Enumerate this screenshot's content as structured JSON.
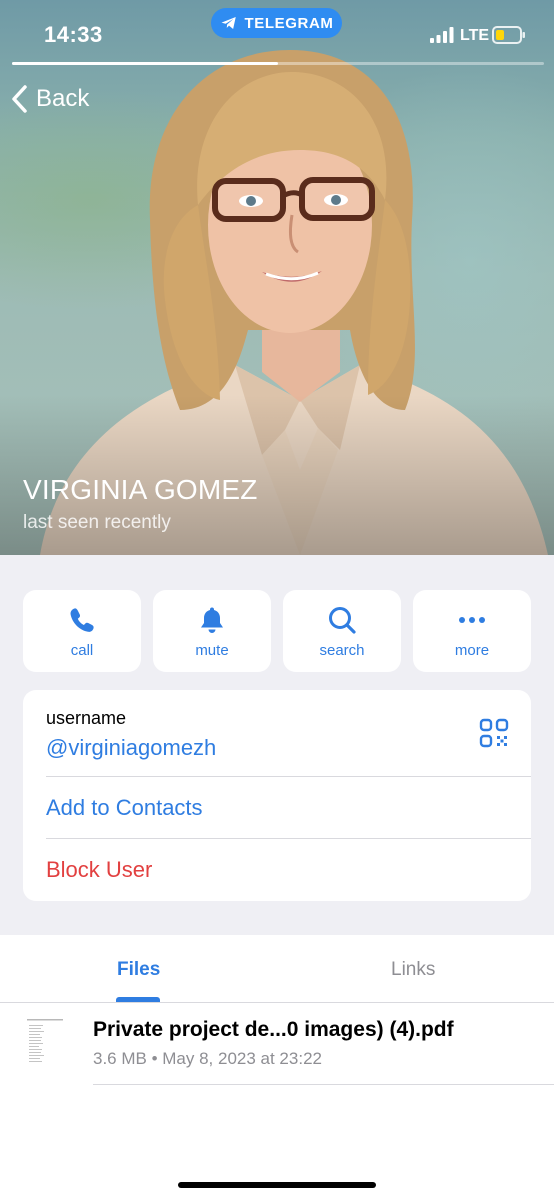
{
  "status_bar": {
    "time": "14:33",
    "app_pill": "TELEGRAM",
    "network": "LTE",
    "story_progress": 0.5
  },
  "header": {
    "back_label": "Back",
    "name": "VIRGINIA GOMEZ",
    "status": "last seen recently"
  },
  "actions": [
    {
      "label": "call",
      "icon": "phone-icon"
    },
    {
      "label": "mute",
      "icon": "bell-icon"
    },
    {
      "label": "search",
      "icon": "search-icon"
    },
    {
      "label": "more",
      "icon": "more-icon"
    }
  ],
  "info": {
    "username_caption": "username",
    "username": "@virginiagomezh",
    "add_contact": "Add to Contacts",
    "block": "Block User"
  },
  "tabs": [
    {
      "label": "Files",
      "active": true
    },
    {
      "label": "Links",
      "active": false
    }
  ],
  "files": [
    {
      "name": "Private project de...0 images) (4).pdf",
      "meta": "3.6 MB • May 8, 2023 at 23:22"
    }
  ],
  "colors": {
    "accent": "#2f7de1",
    "danger": "#e24040",
    "telegram_pill": "#2f8cf1",
    "background": "#efeff4"
  }
}
